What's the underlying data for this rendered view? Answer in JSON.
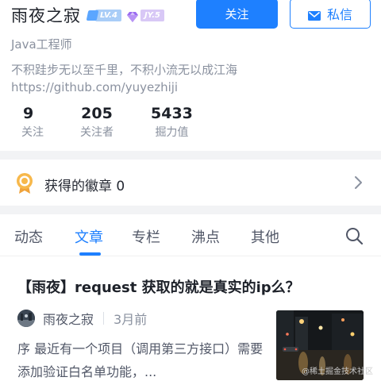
{
  "profile": {
    "username": "雨夜之寂",
    "level_badge": "LV.4",
    "jy_badge": "JY.5",
    "job_title": "Java工程师",
    "bio_line1": "不积跬步无以至千里，不积小流无以成江海",
    "bio_line2": "https://github.com/yuyezhiji",
    "follow_label": "关注",
    "message_label": "私信",
    "stats": [
      {
        "value": "9",
        "label": "关注"
      },
      {
        "value": "205",
        "label": "关注者"
      },
      {
        "value": "5433",
        "label": "掘力值"
      }
    ]
  },
  "badges": {
    "label": "获得的徽章 0"
  },
  "tabs": [
    {
      "label": "动态"
    },
    {
      "label": "文章"
    },
    {
      "label": "专栏"
    },
    {
      "label": "沸点"
    },
    {
      "label": "其他"
    }
  ],
  "article": {
    "title": "【雨夜】request 获取的就是真实的ip么？",
    "author": "雨夜之寂",
    "time": "3月前",
    "summary": "序 最近有一个项目（调用第三方接口）需要添加验证白名单功能，..."
  },
  "watermark": "@稀土掘金技术社区",
  "colors": {
    "accent": "#1e80ff",
    "text_primary": "#1d2129",
    "text_secondary": "#8a919f",
    "section_gap": "#f2f3f5"
  }
}
